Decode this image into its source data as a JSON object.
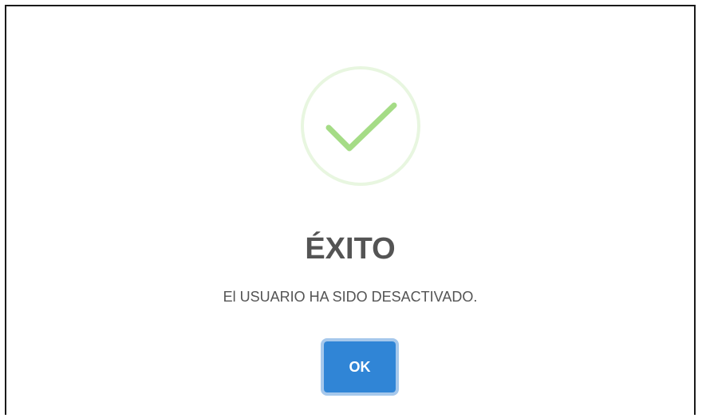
{
  "dialog": {
    "icon": "success-check-icon",
    "accent_color": "#a5dc86",
    "ring_color": "#e8f6e0",
    "title": "ÉXITO",
    "message": "El USUARIO HA SIDO DESACTIVADO.",
    "confirm_label": "OK",
    "confirm_color": "#3085d6"
  }
}
